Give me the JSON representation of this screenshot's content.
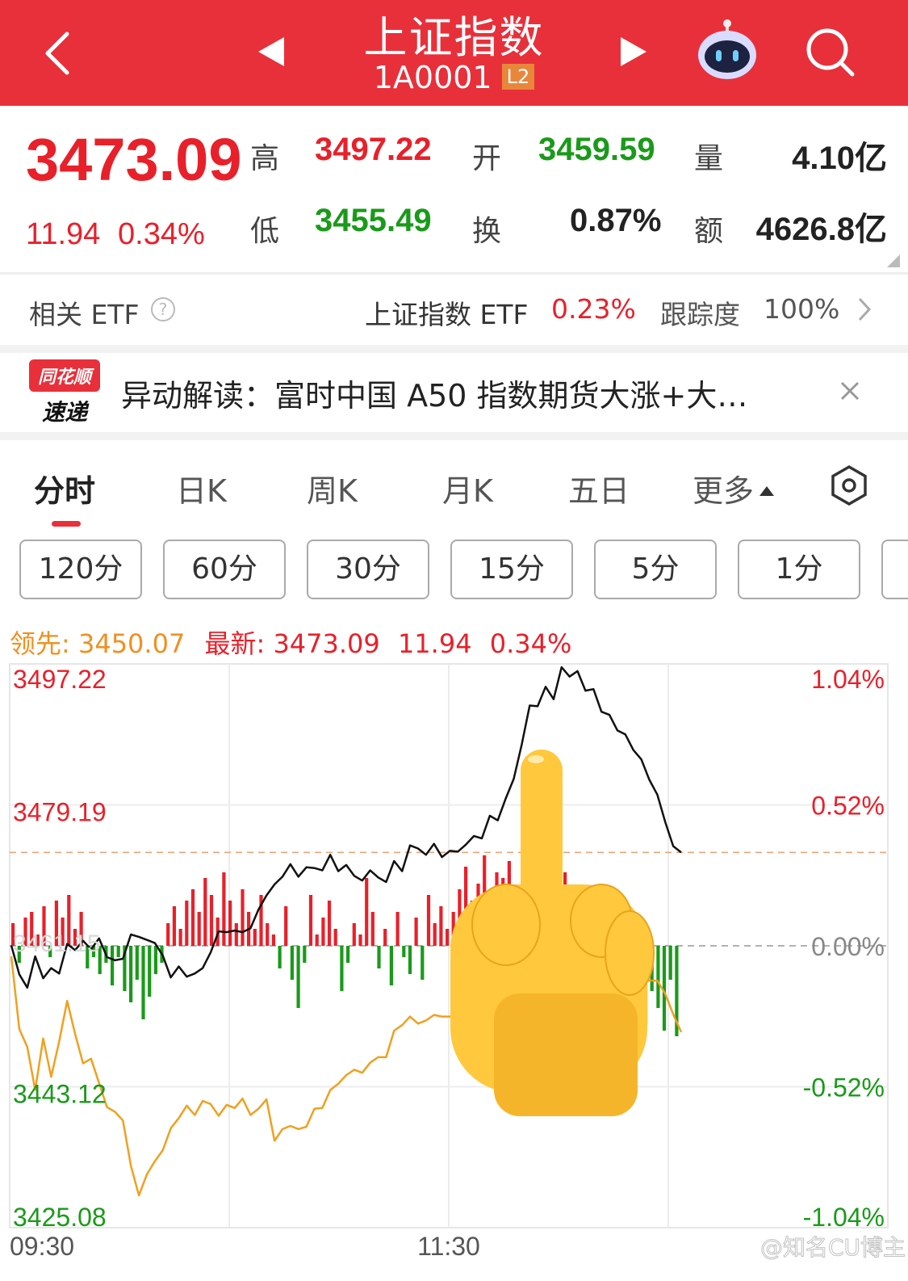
{
  "header": {
    "title": "上证指数",
    "code": "1A0001",
    "level_badge": "L2",
    "icons": [
      "back-icon",
      "prev-stock-icon",
      "next-stock-icon",
      "robot-assistant-icon",
      "search-icon"
    ]
  },
  "quote": {
    "price": "3473.09",
    "change": "11.94",
    "change_pct": "0.34%",
    "high_label": "高",
    "high": "3497.22",
    "open_label": "开",
    "open": "3459.59",
    "volume_label": "量",
    "volume": "4.10亿",
    "low_label": "低",
    "low": "3455.49",
    "turnover_label": "换",
    "turnover": "0.87%",
    "amount_label": "额",
    "amount": "4626.8亿"
  },
  "etf": {
    "label": "相关 ETF",
    "name": "上证指数 ETF",
    "pct": "0.23%",
    "tracking_label": "跟踪度",
    "tracking": "100%"
  },
  "news": {
    "logo_top": "同花顺",
    "logo_bottom": "速递",
    "text": "异动解读：富时中国 A50 指数期货大涨+大…"
  },
  "tabs": [
    "分时",
    "日K",
    "周K",
    "月K",
    "五日",
    "更多"
  ],
  "periods": [
    "120分",
    "60分",
    "30分",
    "15分",
    "5分",
    "1分"
  ],
  "legend": {
    "lead_label": "领先:",
    "lead_value": "3450.07",
    "latest_label": "最新:",
    "latest_value": "3473.09",
    "latest_change": "11.94",
    "latest_pct": "0.34%"
  },
  "overlay_text": "3461.15",
  "watermark": "@知名CU博主",
  "colors": {
    "up": "#e8202a",
    "down": "#1a9a1a",
    "lead": "#f0a020",
    "header": "#e8303a"
  },
  "chart_data": {
    "type": "line",
    "prev_close": 3461.15,
    "ylim": [
      3425.08,
      3497.22
    ],
    "y_ticks_left": [
      "3497.22",
      "3479.19",
      "3443.12",
      "3425.08"
    ],
    "y_ticks_right": [
      "1.04%",
      "0.52%",
      "0.00%",
      "-0.52%",
      "-1.04%"
    ],
    "x_ticks": [
      "09:30",
      "11:30"
    ],
    "series": [
      {
        "name": "最新",
        "values": [
          3461.2,
          3457.5,
          3455.8,
          3459.8,
          3457.0,
          3458.3,
          3457.6,
          3461.4,
          3460.6,
          3461.8,
          3460.7,
          3462.1,
          3459.7,
          3459.3,
          3459.5,
          3462.6,
          3462.3,
          3461.9,
          3461.5,
          3459.9,
          3457.1,
          3458.5,
          3457.2,
          3457.6,
          3458.3,
          3460.3,
          3463.0,
          3462.9,
          3463.1,
          3462.9,
          3463.4,
          3465.8,
          3467.6,
          3469.0,
          3470.0,
          3471.6,
          3470.0,
          3471.2,
          3471.1,
          3470.8,
          3472.8,
          3470.7,
          3471.5,
          3470.1,
          3469.5,
          3470.8,
          3469.9,
          3469.3,
          3472.0,
          3470.7,
          3474.0,
          3473.6,
          3472.8,
          3474.2,
          3472.5,
          3473.3,
          3473.2,
          3474.1,
          3475.2,
          3474.9,
          3477.8,
          3477.2,
          3480.0,
          3482.5,
          3486.9,
          3491.9,
          3491.8,
          3494.3,
          3492.7,
          3496.8,
          3495.6,
          3496.3,
          3493.8,
          3494.0,
          3491.1,
          3490.7,
          3488.7,
          3488.2,
          3486.2,
          3485.0,
          3482.4,
          3480.5,
          3477.0,
          3473.9,
          3473.1
        ]
      },
      {
        "name": "领先",
        "values": [
          3459.8,
          3450.5,
          3448.2,
          3442.7,
          3449.3,
          3444.4,
          3448.9,
          3454.1,
          3449.9,
          3446.1,
          3446.7,
          3443.6,
          3440.5,
          3439.9,
          3438.8,
          3433.0,
          3429.2,
          3431.9,
          3433.6,
          3435.0,
          3437.8,
          3439.1,
          3440.7,
          3439.5,
          3441.3,
          3440.9,
          3439.4,
          3440.8,
          3440.4,
          3441.6,
          3439.5,
          3440.3,
          3441.5,
          3436.2,
          3437.7,
          3438.1,
          3437.7,
          3438.0,
          3440.3,
          3440.4,
          3442.7,
          3443.5,
          3444.6,
          3445.3,
          3444.9,
          3446.2,
          3446.9,
          3446.9,
          3450.3,
          3451.0,
          3452.1,
          3451.2,
          3451.6,
          3452.3,
          3452.1,
          3452.1,
          3451.8,
          3452.1,
          3452.3,
          3452.3,
          3452.8,
          3453.0,
          3453.2,
          3453.5,
          3453.8,
          3454.1,
          3454.1,
          3454.4,
          3454.7,
          3455.0,
          3455.2,
          3455.3,
          3455.6,
          3455.8,
          3456.0,
          3456.2,
          3456.3,
          3456.4,
          3456.5,
          3456.6,
          3456.7,
          3456.7,
          3455.0,
          3452.4,
          3450.1
        ]
      }
    ],
    "volume_bars": [
      4,
      -3,
      5,
      6,
      2,
      7,
      -2,
      8,
      5,
      9,
      3,
      6,
      -4,
      -2,
      -5,
      -3,
      -7,
      -2,
      -8,
      -10,
      -6,
      -13,
      -9,
      -5,
      -3,
      4,
      7,
      3,
      8,
      10,
      6,
      12,
      9,
      5,
      13,
      8,
      4,
      10,
      6,
      3,
      9,
      4,
      2,
      -4,
      7,
      -6,
      -11,
      -3,
      9,
      2,
      5,
      8,
      3,
      -8,
      -3,
      4,
      2,
      12,
      6,
      -4,
      3,
      -7,
      6,
      -2,
      -5,
      5,
      -6,
      9,
      4,
      7,
      3,
      6,
      10,
      14,
      8,
      11,
      16,
      9,
      13,
      12,
      15,
      10,
      7,
      5,
      -4,
      3,
      -7,
      4,
      11,
      13,
      9,
      7,
      -6,
      -9,
      -4,
      -12,
      -2,
      -8,
      -5,
      -3,
      3,
      2,
      -14,
      -8,
      -11,
      -15,
      -6,
      -16
    ]
  }
}
